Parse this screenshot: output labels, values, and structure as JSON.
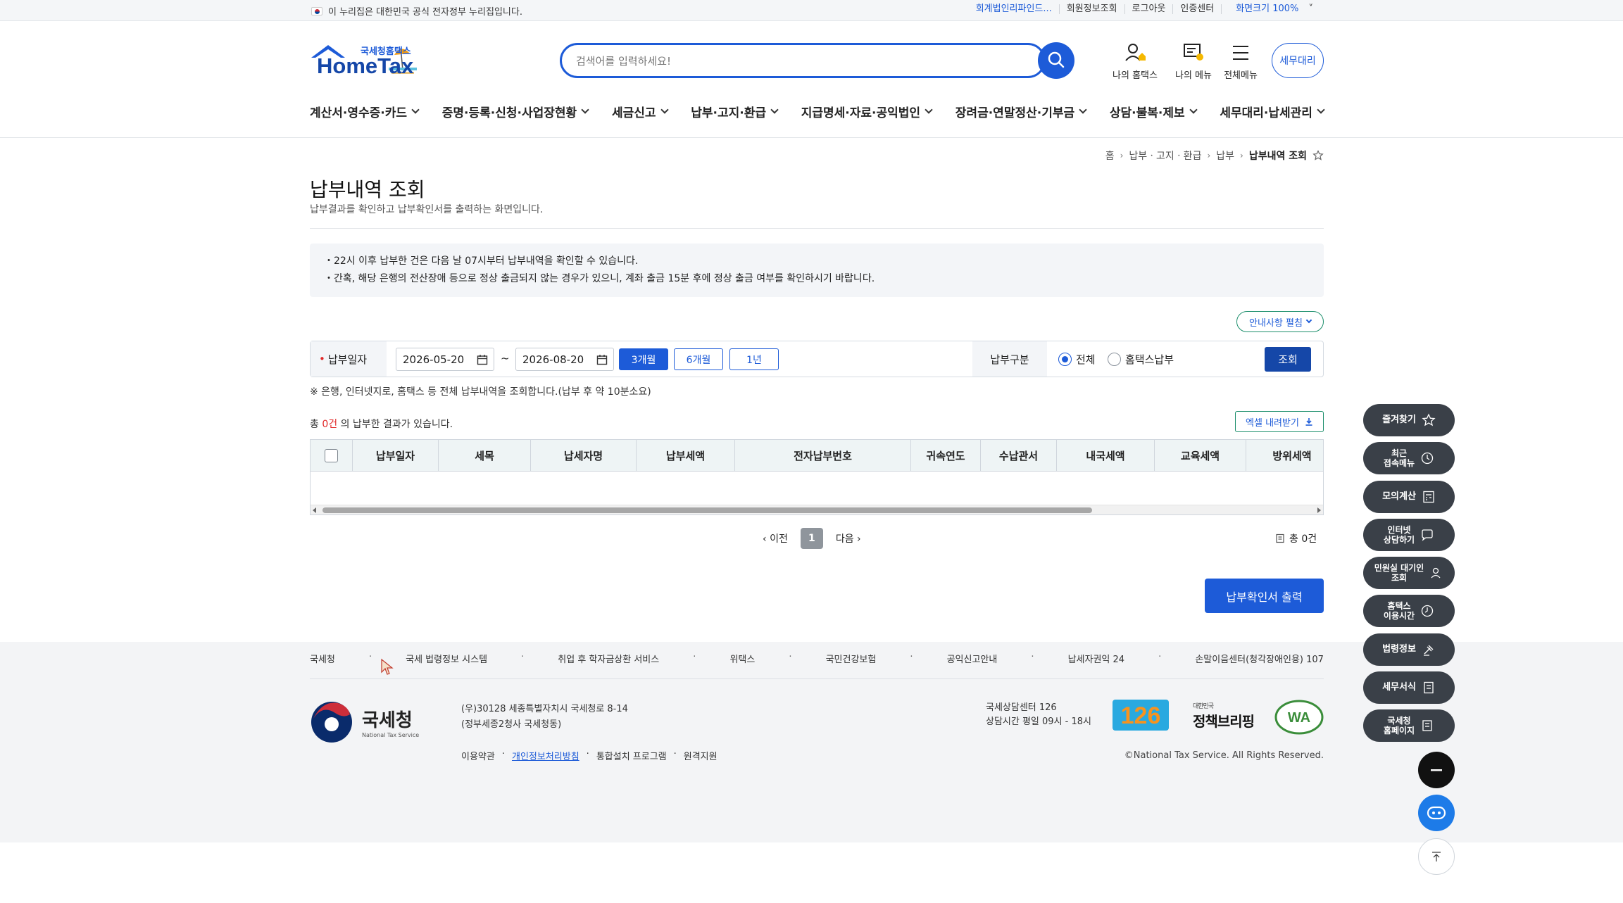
{
  "topbar": {
    "notice": "이 누리집은 대한민국 공식 전자정부 누리집입니다.",
    "links": [
      "회계법인리파인드...",
      "회원정보조회",
      "로그아웃",
      "인증센터",
      "화면크기 100%"
    ]
  },
  "header": {
    "logo_small": "국세청홈택스",
    "logo_main": "HomeTax",
    "search_placeholder": "검색어를 입력하세요!",
    "icons": [
      {
        "label": "나의 홈택스",
        "icon": "my-hometax-icon"
      },
      {
        "label": "나의 메뉴",
        "icon": "my-menu-icon"
      },
      {
        "label": "전체메뉴",
        "icon": "all-menu-icon"
      }
    ],
    "tax_agent": "세무대리"
  },
  "gnb": [
    "계산서·영수증·카드",
    "증명·등록·신청·사업장현황",
    "세금신고",
    "납부·고지·환급",
    "지급명세·자료·공익법인",
    "장려금·연말정산·기부금",
    "상담·불복·제보",
    "세무대리·납세관리"
  ],
  "breadcrumb": [
    "홈",
    "납부ㆍ고지ㆍ환급",
    "납부",
    "납부내역 조회"
  ],
  "page": {
    "title": "납부내역 조회",
    "desc": "납부결과를 확인하고 납부확인서를 출력하는 화면입니다."
  },
  "notices": [
    "22시 이후 납부한 건은 다음 날 07시부터 납부내역을 확인할 수 있습니다.",
    "간혹, 해당 은행의 전산장애 등으로 정상 출금되지 않는 경우가 있으니, 계좌 출금 15분 후에 정상 출금 여부를 확인하시기 바랍니다."
  ],
  "guide_toggle": "안내사항 펼침",
  "form": {
    "date_label": "납부일자",
    "date_from": "2026-05-20",
    "date_sep": "~",
    "date_to": "2026-08-20",
    "periods": [
      "3개월",
      "6개월",
      "1년"
    ],
    "selected_period": "3개월",
    "type_label": "납부구분",
    "radios": [
      "전체",
      "홈택스납부"
    ],
    "selected_radio": "전체",
    "query": "조회",
    "note": "※ 은행, 인터넷지로, 홈택스 등 전체 납부내역을 조회합니다.(납부 후 약 10분소요)"
  },
  "results": {
    "prefix": "총 ",
    "count": "0건",
    "suffix": " 의 납부한 결과가 있습니다.",
    "excel": "엑셀 내려받기",
    "columns": [
      "납부일자",
      "세목",
      "납세자명",
      "납부세액",
      "전자납부번호",
      "귀속연도",
      "수납관서",
      "내국세액",
      "교육세액",
      "방위세액"
    ]
  },
  "paging": {
    "prev": "이전",
    "current": "1",
    "next": "다음",
    "total": "총 0건"
  },
  "print_button": "납부확인서 출력",
  "footer": {
    "links": [
      "국세청",
      "국세 법령정보 시스템",
      "취업 후 학자금상환 서비스",
      "위택스",
      "국민건강보험",
      "공익신고안내",
      "납세자권익 24",
      "손말이음센터(청각장애인용) 107"
    ],
    "org_name": "국세청",
    "org_en": "National Tax Service",
    "address1": "(우)30128 세종특별자치시 국세청로 8-14",
    "address2": "(정부세종2청사 국세청동)",
    "sub_links": [
      "이용약관",
      "개인정보처리방침",
      "통합설치 프로그램",
      "원격지원"
    ],
    "center_title": "국세상담센터 126",
    "center_hours": "상담시간 평일 09시 - 18시",
    "logo126": "126",
    "policy_small": "대한민국",
    "policy_main": "정책브리핑",
    "wa_mark": "WA",
    "copyright": "©National Tax Service. All Rights Reserved."
  },
  "quick_menu": [
    {
      "label": "즐겨찾기",
      "icon": "star-icon"
    },
    {
      "label": "최근\n접속메뉴",
      "icon": "clock-icon"
    },
    {
      "label": "모의계산",
      "icon": "calculator-icon"
    },
    {
      "label": "인터넷\n상담하기",
      "icon": "chat-icon"
    },
    {
      "label": "민원실 대기인\n조회",
      "icon": "person-search-icon"
    },
    {
      "label": "홈택스\n이용시간",
      "icon": "time-icon"
    },
    {
      "label": "법령정보",
      "icon": "law-icon"
    },
    {
      "label": "세무서식",
      "icon": "form-icon"
    },
    {
      "label": "국세청\n홈페이지",
      "icon": "building-icon"
    }
  ],
  "colors": {
    "primary": "#1d5bd8",
    "navy": "#1547a8",
    "quick_bg": "#3a4048",
    "red": "#e12828"
  }
}
